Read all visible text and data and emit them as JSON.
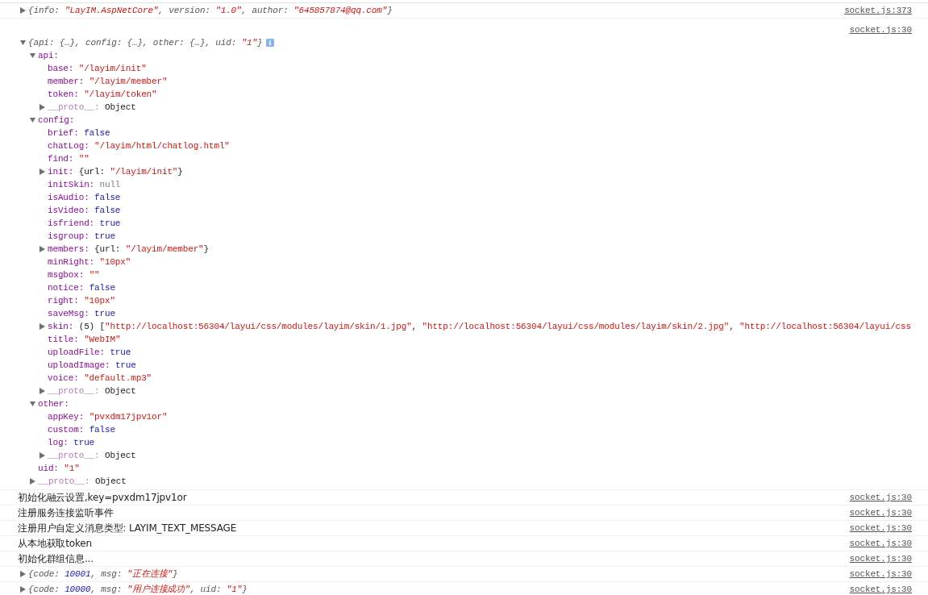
{
  "messages": [
    {
      "kind": "object",
      "expanded": false,
      "source": "socket.js:373",
      "summary": [
        {
          "kind": "punct",
          "text": "{"
        },
        {
          "kind": "key",
          "text": "info: "
        },
        {
          "kind": "string",
          "text": "\"LayIM.AspNetCore\""
        },
        {
          "kind": "punct",
          "text": ", "
        },
        {
          "kind": "key",
          "text": "version: "
        },
        {
          "kind": "string",
          "text": "\"1.0\""
        },
        {
          "kind": "punct",
          "text": ", "
        },
        {
          "kind": "key",
          "text": "author: "
        },
        {
          "kind": "string",
          "text": "\"645857874@qq.com\""
        },
        {
          "kind": "punct",
          "text": "}"
        }
      ]
    },
    {
      "kind": "object",
      "expanded": true,
      "source": "socket.js:30",
      "summary": [
        {
          "kind": "punct",
          "text": "{"
        },
        {
          "kind": "key",
          "text": "api: "
        },
        {
          "kind": "punct",
          "text": "{…}, "
        },
        {
          "kind": "key",
          "text": "config: "
        },
        {
          "kind": "punct",
          "text": "{…}, "
        },
        {
          "kind": "key",
          "text": "other: "
        },
        {
          "kind": "punct",
          "text": "{…}, "
        },
        {
          "kind": "key",
          "text": "uid: "
        },
        {
          "kind": "string",
          "text": "\"1\""
        },
        {
          "kind": "punct",
          "text": "}"
        }
      ],
      "children": [
        {
          "key": "api:",
          "kind": "prop",
          "expanded": true,
          "children": [
            {
              "key": "base:",
              "kind": "prop",
              "value": [
                {
                  "kind": "string",
                  "text": "\"/layim/init\""
                }
              ]
            },
            {
              "key": "member:",
              "kind": "prop",
              "value": [
                {
                  "kind": "string",
                  "text": "\"/layim/member\""
                }
              ]
            },
            {
              "key": "token:",
              "kind": "prop",
              "value": [
                {
                  "kind": "string",
                  "text": "\"/layim/token\""
                }
              ]
            },
            {
              "key": "__proto__:",
              "kind": "internal",
              "expanded": false,
              "value": [
                {
                  "kind": "plain",
                  "text": "Object"
                }
              ]
            }
          ]
        },
        {
          "key": "config:",
          "kind": "prop",
          "expanded": true,
          "children": [
            {
              "key": "brief:",
              "kind": "prop",
              "value": [
                {
                  "kind": "number",
                  "text": "false"
                }
              ]
            },
            {
              "key": "chatLog:",
              "kind": "prop",
              "value": [
                {
                  "kind": "string",
                  "text": "\"/layim/html/chatlog.html\""
                }
              ]
            },
            {
              "key": "find:",
              "kind": "prop",
              "value": [
                {
                  "kind": "string",
                  "text": "\"\""
                }
              ]
            },
            {
              "key": "init:",
              "kind": "prop",
              "expanded": false,
              "value": [
                {
                  "kind": "plain",
                  "text": "{url: "
                },
                {
                  "kind": "string",
                  "text": "\"/layim/init\""
                },
                {
                  "kind": "plain",
                  "text": "}"
                }
              ]
            },
            {
              "key": "initSkin:",
              "kind": "prop",
              "value": [
                {
                  "kind": "null",
                  "text": "null"
                }
              ]
            },
            {
              "key": "isAudio:",
              "kind": "prop",
              "value": [
                {
                  "kind": "number",
                  "text": "false"
                }
              ]
            },
            {
              "key": "isVideo:",
              "kind": "prop",
              "value": [
                {
                  "kind": "number",
                  "text": "false"
                }
              ]
            },
            {
              "key": "isfriend:",
              "kind": "prop",
              "value": [
                {
                  "kind": "number",
                  "text": "true"
                }
              ]
            },
            {
              "key": "isgroup:",
              "kind": "prop",
              "value": [
                {
                  "kind": "number",
                  "text": "true"
                }
              ]
            },
            {
              "key": "members:",
              "kind": "prop",
              "expanded": false,
              "value": [
                {
                  "kind": "plain",
                  "text": "{url: "
                },
                {
                  "kind": "string",
                  "text": "\"/layim/member\""
                },
                {
                  "kind": "plain",
                  "text": "}"
                }
              ]
            },
            {
              "key": "minRight:",
              "kind": "prop",
              "value": [
                {
                  "kind": "string",
                  "text": "\"10px\""
                }
              ]
            },
            {
              "key": "msgbox:",
              "kind": "prop",
              "value": [
                {
                  "kind": "string",
                  "text": "\"\""
                }
              ]
            },
            {
              "key": "notice:",
              "kind": "prop",
              "value": [
                {
                  "kind": "number",
                  "text": "false"
                }
              ]
            },
            {
              "key": "right:",
              "kind": "prop",
              "value": [
                {
                  "kind": "string",
                  "text": "\"10px\""
                }
              ]
            },
            {
              "key": "saveMsg:",
              "kind": "prop",
              "value": [
                {
                  "kind": "number",
                  "text": "true"
                }
              ]
            },
            {
              "key": "skin:",
              "kind": "prop",
              "expanded": false,
              "value": [
                {
                  "kind": "plain",
                  "text": "(5) ["
                },
                {
                  "kind": "string",
                  "text": "\"http://localhost:56304/layui/css/modules/layim/skin/1.jpg\""
                },
                {
                  "kind": "plain",
                  "text": ", "
                },
                {
                  "kind": "string",
                  "text": "\"http://localhost:56304/layui/css/modules/layim/skin/2.jpg\""
                },
                {
                  "kind": "plain",
                  "text": ", "
                },
                {
                  "kind": "string",
                  "text": "\"http://localhost:56304/layui/css"
                }
              ]
            },
            {
              "key": "title:",
              "kind": "prop",
              "value": [
                {
                  "kind": "string",
                  "text": "\"WebIM\""
                }
              ]
            },
            {
              "key": "uploadFile:",
              "kind": "prop",
              "value": [
                {
                  "kind": "number",
                  "text": "true"
                }
              ]
            },
            {
              "key": "uploadImage:",
              "kind": "prop",
              "value": [
                {
                  "kind": "number",
                  "text": "true"
                }
              ]
            },
            {
              "key": "voice:",
              "kind": "prop",
              "value": [
                {
                  "kind": "string",
                  "text": "\"default.mp3\""
                }
              ]
            },
            {
              "key": "__proto__:",
              "kind": "internal",
              "expanded": false,
              "value": [
                {
                  "kind": "plain",
                  "text": "Object"
                }
              ]
            }
          ]
        },
        {
          "key": "other:",
          "kind": "prop",
          "expanded": true,
          "children": [
            {
              "key": "appKey:",
              "kind": "prop",
              "value": [
                {
                  "kind": "string",
                  "text": "\"pvxdm17jpv1or\""
                }
              ]
            },
            {
              "key": "custom:",
              "kind": "prop",
              "value": [
                {
                  "kind": "number",
                  "text": "false"
                }
              ]
            },
            {
              "key": "log:",
              "kind": "prop",
              "value": [
                {
                  "kind": "number",
                  "text": "true"
                }
              ]
            },
            {
              "key": "__proto__:",
              "kind": "internal",
              "expanded": false,
              "value": [
                {
                  "kind": "plain",
                  "text": "Object"
                }
              ]
            }
          ]
        },
        {
          "key": "uid:",
          "kind": "prop",
          "value": [
            {
              "kind": "string",
              "text": "\"1\""
            }
          ]
        },
        {
          "key": "__proto__:",
          "kind": "internal",
          "expanded": false,
          "value": [
            {
              "kind": "plain",
              "text": "Object"
            }
          ]
        }
      ]
    },
    {
      "kind": "text",
      "text": "初始化融云设置,key=pvxdm17jpv1or",
      "source": "socket.js:30"
    },
    {
      "kind": "text",
      "text": "注册服务连接监听事件",
      "source": "socket.js:30"
    },
    {
      "kind": "text",
      "text": "注册用户自定义消息类型: LAYIM_TEXT_MESSAGE",
      "source": "socket.js:30"
    },
    {
      "kind": "text",
      "text": "从本地获取token",
      "source": "socket.js:30"
    },
    {
      "kind": "text",
      "text": "初始化群组信息...",
      "source": "socket.js:30"
    },
    {
      "kind": "object",
      "expanded": false,
      "source": "socket.js:30",
      "summary": [
        {
          "kind": "punct",
          "text": "{"
        },
        {
          "kind": "key",
          "text": "code: "
        },
        {
          "kind": "number",
          "text": "10001"
        },
        {
          "kind": "punct",
          "text": ", "
        },
        {
          "kind": "key",
          "text": "msg: "
        },
        {
          "kind": "string",
          "text": "\"正在连接\""
        },
        {
          "kind": "punct",
          "text": "}"
        }
      ]
    },
    {
      "kind": "object",
      "expanded": false,
      "source": "socket.js:30",
      "summary": [
        {
          "kind": "punct",
          "text": "{"
        },
        {
          "kind": "key",
          "text": "code: "
        },
        {
          "kind": "number",
          "text": "10000"
        },
        {
          "kind": "punct",
          "text": ", "
        },
        {
          "kind": "key",
          "text": "msg: "
        },
        {
          "kind": "string",
          "text": "\"用户连接成功\""
        },
        {
          "kind": "punct",
          "text": ", "
        },
        {
          "kind": "key",
          "text": "uid: "
        },
        {
          "kind": "string",
          "text": "\"1\""
        },
        {
          "kind": "punct",
          "text": "}"
        }
      ]
    }
  ]
}
